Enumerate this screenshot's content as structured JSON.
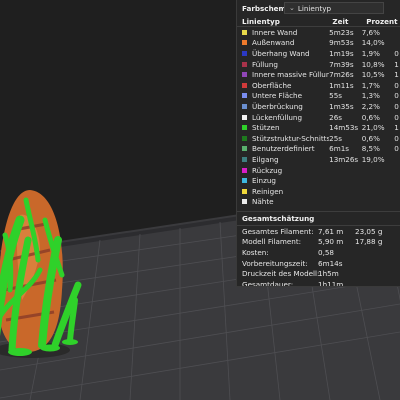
{
  "panel": {
    "title": "Farbschema",
    "dropdown_value": "Linientyp",
    "columns": {
      "type": "Linientyp",
      "time": "Zeit",
      "percent": "Prozent"
    },
    "rows": [
      {
        "label": "Innere Wand",
        "time": "5m23s",
        "percent": "7,6%",
        "tail": "",
        "color": "#e6d84a"
      },
      {
        "label": "Außenwand",
        "time": "9m53s",
        "percent": "14,0%",
        "tail": "",
        "color": "#ee7a2c"
      },
      {
        "label": "Überhang Wand",
        "time": "1m19s",
        "percent": "1,9%",
        "tail": "0",
        "color": "#2b39c4"
      },
      {
        "label": "Füllung",
        "time": "7m39s",
        "percent": "10,8%",
        "tail": "1",
        "color": "#a8324a"
      },
      {
        "label": "Innere massive Füllung",
        "time": "7m26s",
        "percent": "10,5%",
        "tail": "1",
        "color": "#9046b8"
      },
      {
        "label": "Oberfläche",
        "time": "1m11s",
        "percent": "1,7%",
        "tail": "0",
        "color": "#d13a3a"
      },
      {
        "label": "Untere Fläche",
        "time": "55s",
        "percent": "1,3%",
        "tail": "0",
        "color": "#7a8df0"
      },
      {
        "label": "Überbrückung",
        "time": "1m35s",
        "percent": "2,2%",
        "tail": "0",
        "color": "#6a8fd0"
      },
      {
        "label": "Lückenfüllung",
        "time": "26s",
        "percent": "0,6%",
        "tail": "0",
        "color": "#f4f4f4"
      },
      {
        "label": "Stützen",
        "time": "14m53s",
        "percent": "21,0%",
        "tail": "1",
        "color": "#2fd12a"
      },
      {
        "label": "Stützstruktur-Schnittstelle",
        "time": "25s",
        "percent": "0,6%",
        "tail": "0",
        "color": "#1e7a1e"
      },
      {
        "label": "Benutzerdefiniert",
        "time": "6m1s",
        "percent": "8,5%",
        "tail": "0",
        "color": "#5ab06e"
      },
      {
        "label": "Eilgang",
        "time": "13m26s",
        "percent": "19,0%",
        "tail": "",
        "color": "#3d7f80"
      },
      {
        "label": "Rückzug",
        "time": "",
        "percent": "",
        "tail": "",
        "color": "#d81ec8"
      },
      {
        "label": "Einzug",
        "time": "",
        "percent": "",
        "tail": "",
        "color": "#3db8e0"
      },
      {
        "label": "Reinigen",
        "time": "",
        "percent": "",
        "tail": "",
        "color": "#f0d83a"
      },
      {
        "label": "Nähte",
        "time": "",
        "percent": "",
        "tail": "",
        "color": "#ececec"
      }
    ],
    "estimate": {
      "title": "Gesamtschätzung",
      "rows": [
        {
          "label": "Gesamtes Filament:",
          "a": "7,61 m",
          "b": "23,05 g"
        },
        {
          "label": "Modell Filament:",
          "a": "5,90 m",
          "b": "17,88 g"
        },
        {
          "label": "Kosten:",
          "a": "0,58",
          "b": ""
        },
        {
          "label": "Vorbereitungszeit:",
          "a": "6m14s",
          "b": ""
        },
        {
          "label": "Druckzeit des Modell:",
          "a": "1h5m",
          "b": ""
        },
        {
          "label": "Gesamtdauer:",
          "a": "1h11m",
          "b": ""
        }
      ]
    }
  },
  "colors": {
    "background": "#1f1f1f",
    "bed": "#3a3a3d",
    "grid": "#4d4d51",
    "support": "#2fd12a",
    "model": "#d0742e"
  }
}
